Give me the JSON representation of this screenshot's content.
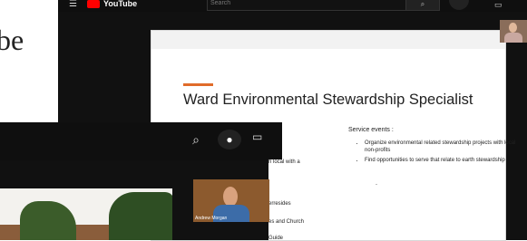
{
  "background_text": "be",
  "youtube": {
    "logo_text": "YouTube",
    "search_placeholder": "Search"
  },
  "slide": {
    "title": "Ward Environmental Stewardship Specialist",
    "service_heading": "Service events :",
    "bullets": [
      "Organize environmental related stewardship projects with local non-profits",
      "Find opportunities to serve that relate to earth stewardship"
    ],
    "dash": "-"
  },
  "front": {
    "side_lines": [
      "h local with a",
      "erresides",
      "es and Church",
      "Guide"
    ],
    "webcam_name": "Andrew Morgan"
  },
  "colors": {
    "accent": "#e06b2a",
    "youtube_red": "#ff0000"
  }
}
